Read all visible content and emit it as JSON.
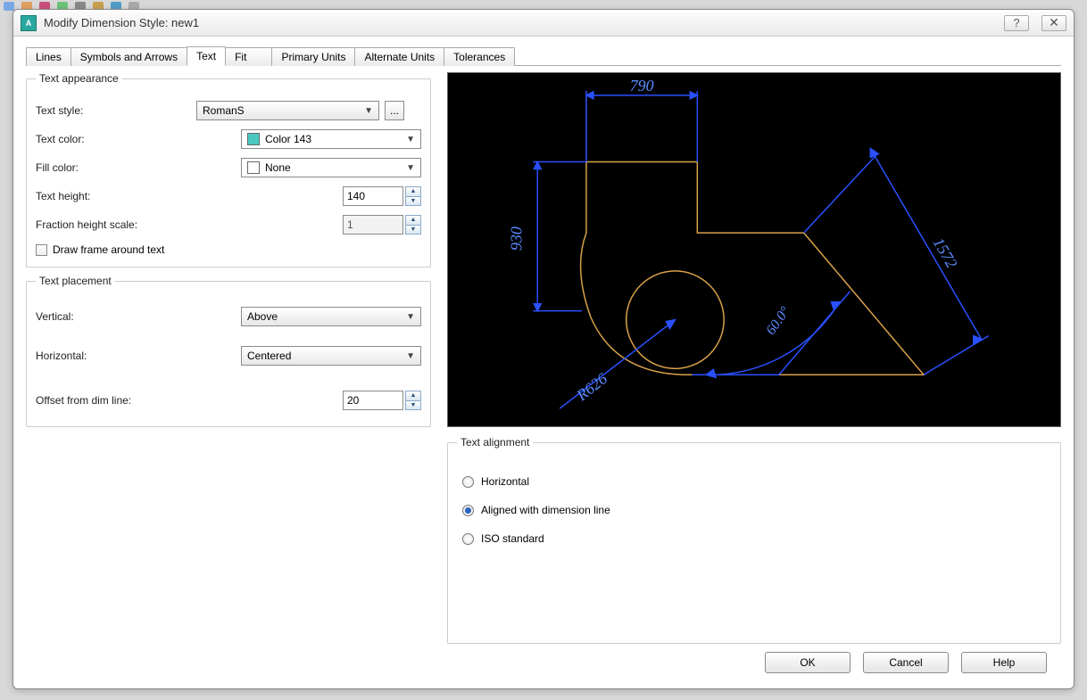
{
  "window": {
    "title": "Modify Dimension Style: new1",
    "helpGlyph": "?",
    "closeGlyph": "✕"
  },
  "tabs": [
    {
      "label": "Lines"
    },
    {
      "label": "Symbols and Arrows"
    },
    {
      "label": "Text",
      "active": true
    },
    {
      "label": "Fit"
    },
    {
      "label": "Primary Units"
    },
    {
      "label": "Alternate Units"
    },
    {
      "label": "Tolerances"
    }
  ],
  "appearance": {
    "legend": "Text appearance",
    "textStyle": {
      "label": "Text style:",
      "value": "RomanS",
      "more": "..."
    },
    "textColor": {
      "label": "Text color:",
      "value": "Color 143",
      "swatch": "#4bc9c0"
    },
    "fillColor": {
      "label": "Fill color:",
      "value": "None"
    },
    "textHeight": {
      "label": "Text height:",
      "value": "140"
    },
    "fractionScale": {
      "label": "Fraction height scale:",
      "value": "1",
      "disabled": true
    },
    "drawFrame": {
      "label": "Draw frame around text",
      "checked": false
    }
  },
  "placement": {
    "legend": "Text placement",
    "vertical": {
      "label": "Vertical:",
      "value": "Above"
    },
    "horizontal": {
      "label": "Horizontal:",
      "value": "Centered"
    },
    "offset": {
      "label": "Offset from dim line:",
      "value": "20"
    }
  },
  "alignment": {
    "legend": "Text alignment",
    "options": [
      {
        "label": "Horizontal",
        "checked": false
      },
      {
        "label": "Aligned with dimension line",
        "checked": true
      },
      {
        "label": "ISO standard",
        "checked": false
      }
    ]
  },
  "preview": {
    "dims": {
      "top": "790",
      "left": "930",
      "radius": "R626",
      "right": "1572",
      "angle": "60.0°"
    }
  },
  "buttons": {
    "ok": "OK",
    "cancel": "Cancel",
    "help": "Help"
  }
}
